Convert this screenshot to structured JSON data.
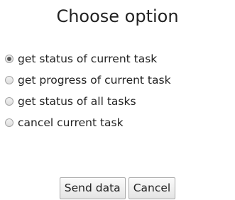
{
  "dialog": {
    "title": "Choose option",
    "options": [
      {
        "label": "get status of current task",
        "selected": true
      },
      {
        "label": "get progress of current task",
        "selected": false
      },
      {
        "label": "get status of all tasks",
        "selected": false
      },
      {
        "label": "cancel current task",
        "selected": false
      }
    ],
    "send_label": "Send data",
    "cancel_label": "Cancel"
  }
}
